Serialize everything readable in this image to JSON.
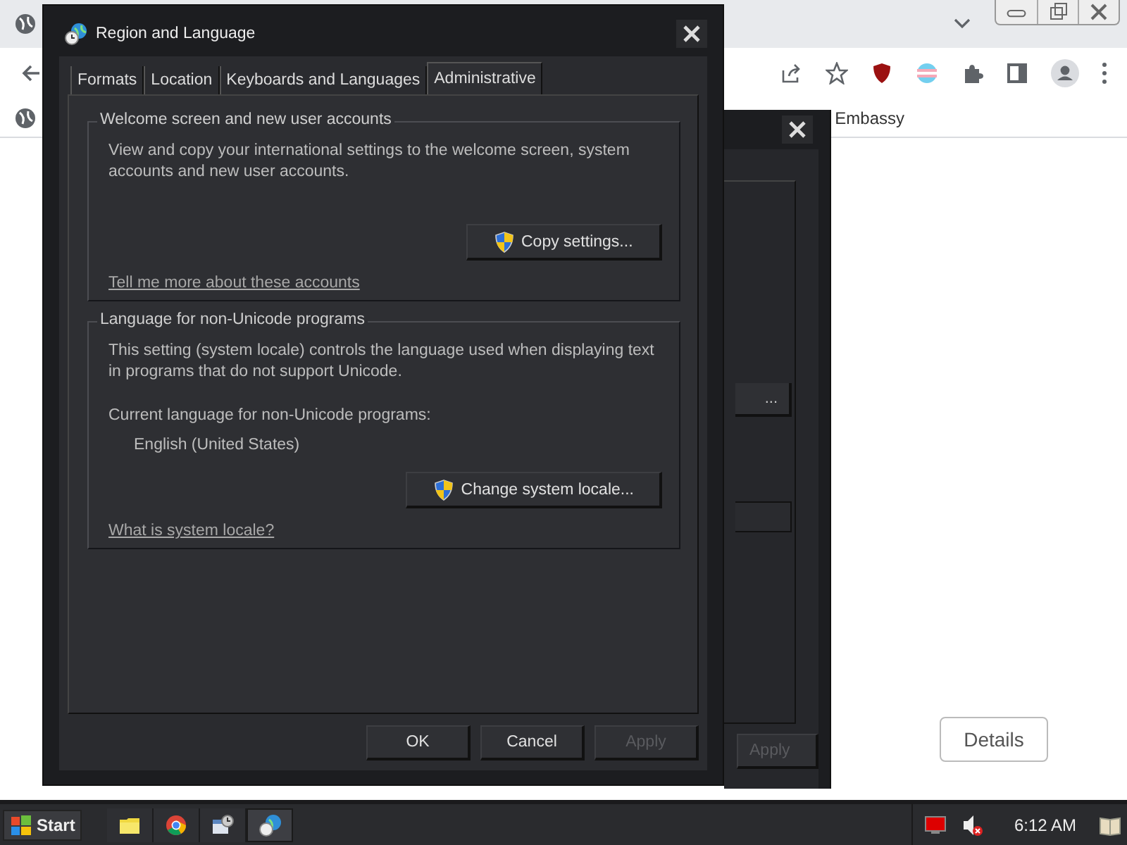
{
  "browser": {
    "bookmark": "Embassy",
    "details_button": "Details"
  },
  "dialog": {
    "title": "Region and Language",
    "tabs": [
      {
        "label": "Formats",
        "selected": false
      },
      {
        "label": "Location",
        "selected": false
      },
      {
        "label": "Keyboards and Languages",
        "selected": false
      },
      {
        "label": "Administrative",
        "selected": true
      }
    ],
    "groups": [
      {
        "title": "Welcome screen and new user accounts",
        "description": "View and copy your international settings to the welcome screen, system accounts and new user accounts.",
        "button": "Copy settings...",
        "link": "Tell me more about these accounts"
      },
      {
        "title": "Language for non-Unicode programs",
        "description": "This setting (system locale) controls the language used when displaying text in programs that do not support Unicode.",
        "current_label": "Current language for non-Unicode programs:",
        "current_value": "English (United States)",
        "button": "Change system locale...",
        "link": "What is system locale?"
      }
    ],
    "buttons": [
      {
        "label": "OK",
        "disabled": false
      },
      {
        "label": "Cancel",
        "disabled": false
      },
      {
        "label": "Apply",
        "disabled": true
      }
    ]
  },
  "back_dialog": {
    "button_text": "...",
    "apply": {
      "label": "Apply",
      "disabled": true
    }
  },
  "taskbar": {
    "start": "Start",
    "apps": [
      {
        "kind": "folder",
        "selected": false
      },
      {
        "kind": "chrome",
        "selected": false
      },
      {
        "kind": "calendar",
        "selected": false
      },
      {
        "kind": "globe",
        "selected": true
      }
    ],
    "clock": "6:12 AM"
  }
}
